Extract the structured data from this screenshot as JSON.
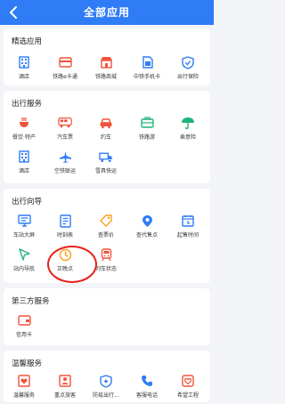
{
  "header": {
    "title": "全部应用"
  },
  "sections": [
    {
      "title": "精选应用",
      "items": [
        {
          "label": "酒店",
          "icon": "building-icon"
        },
        {
          "label": "铁路e卡通",
          "icon": "card-icon"
        },
        {
          "label": "铁路商城",
          "icon": "mall-icon"
        },
        {
          "label": "中铁手机卡",
          "icon": "sim-icon"
        },
        {
          "label": "出行保险",
          "icon": "shield-icon"
        }
      ]
    },
    {
      "title": "出行服务",
      "items": [
        {
          "label": "餐饮·特产",
          "icon": "food-icon"
        },
        {
          "label": "汽车票",
          "icon": "bus-icon"
        },
        {
          "label": "约车",
          "icon": "car-icon"
        },
        {
          "label": "铁路游",
          "icon": "travel-icon"
        },
        {
          "label": "乘意险",
          "icon": "umbrella-icon"
        },
        {
          "label": "酒店",
          "icon": "building-icon"
        },
        {
          "label": "空铁联运",
          "icon": "plane-icon"
        },
        {
          "label": "雪具快运",
          "icon": "truck-icon"
        }
      ]
    },
    {
      "title": "出行向导",
      "items": [
        {
          "label": "车站大屏",
          "icon": "screen-icon"
        },
        {
          "label": "时刻表",
          "icon": "schedule-icon"
        },
        {
          "label": "查票价",
          "icon": "price-icon"
        },
        {
          "label": "查代售点",
          "icon": "location-icon"
        },
        {
          "label": "起售时间",
          "icon": "sale-time-icon"
        },
        {
          "label": "站内导航",
          "icon": "navigation-icon"
        },
        {
          "label": "正晚点",
          "icon": "clock-icon"
        },
        {
          "label": "列车状态",
          "icon": "train-icon"
        }
      ]
    },
    {
      "title": "第三方服务",
      "items": [
        {
          "label": "信用卡",
          "icon": "credit-card-icon"
        }
      ]
    },
    {
      "title": "温馨服务",
      "items": [
        {
          "label": "温馨服务",
          "icon": "heart-icon"
        },
        {
          "label": "重点旅客",
          "icon": "passenger-icon"
        },
        {
          "label": "防疫出行...",
          "icon": "mask-shield-icon"
        },
        {
          "label": "客服电话",
          "icon": "phone-icon"
        },
        {
          "label": "希望工程",
          "icon": "hope-icon"
        }
      ]
    }
  ],
  "colors": {
    "header": "#2f7cf6",
    "blue": "#2f7cf6",
    "red": "#f0533c",
    "orange": "#f7a21b",
    "green": "#22b37a",
    "annotation": "#e8201a"
  }
}
